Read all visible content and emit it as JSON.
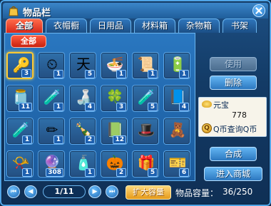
{
  "window": {
    "title": "物品栏"
  },
  "tabs": [
    {
      "label": "全部",
      "active": true
    },
    {
      "label": "衣帽橱",
      "active": false
    },
    {
      "label": "日用品",
      "active": false
    },
    {
      "label": "材料箱",
      "active": false
    },
    {
      "label": "杂物箱",
      "active": false
    },
    {
      "label": "书架",
      "active": false
    }
  ],
  "subtab": {
    "label": "全部"
  },
  "items": [
    {
      "icon": "magnifier-key-icon",
      "glyph": "🔑",
      "count": "3",
      "selected": true
    },
    {
      "icon": "clock-hat-icon",
      "glyph": "⏲",
      "count": "1"
    },
    {
      "icon": "blue-sticker-icon",
      "glyph": "天",
      "count": "5"
    },
    {
      "icon": "noodle-bowl-icon",
      "glyph": "🍜",
      "count": "1"
    },
    {
      "icon": "scroll-icon",
      "glyph": "📜",
      "count": "1"
    },
    {
      "icon": "battery-icon",
      "glyph": "🔋",
      "count": "1"
    },
    {
      "icon": "jar-icon",
      "glyph": "🫙",
      "count": "11"
    },
    {
      "icon": "red-vial-icon",
      "glyph": "🧪",
      "count": "1"
    },
    {
      "icon": "green-potion-icon",
      "glyph": "🍶",
      "count": "4"
    },
    {
      "icon": "clover-icon",
      "glyph": "🍀",
      "count": "3"
    },
    {
      "icon": "orange-vial-icon",
      "glyph": "🧪",
      "count": "5"
    },
    {
      "icon": "purple-book-icon",
      "glyph": "📘",
      "count": "4"
    },
    {
      "icon": "blue-vial-icon",
      "glyph": "🧪",
      "count": "1"
    },
    {
      "icon": "pencil-icon",
      "glyph": "✏",
      "count": "1"
    },
    {
      "icon": "green-bottle-icon",
      "glyph": "🍾",
      "count": "2"
    },
    {
      "icon": "green-book-icon",
      "glyph": "📗",
      "count": "12"
    },
    {
      "icon": "red-hat-icon",
      "glyph": "🎩",
      "count": ""
    },
    {
      "icon": "purple-figure-icon",
      "glyph": "🧸",
      "count": ""
    },
    {
      "icon": "horn-icon",
      "glyph": "📯",
      "count": "1"
    },
    {
      "icon": "crystal-ball-icon",
      "glyph": "🔮",
      "count": "308"
    },
    {
      "icon": "small-bottle-icon",
      "glyph": "🧴",
      "count": "1"
    },
    {
      "icon": "pumpkin-icon",
      "glyph": "🎃",
      "count": "2"
    },
    {
      "icon": "green-package-icon",
      "glyph": "🎁",
      "count": "5"
    },
    {
      "icon": "tickets-icon",
      "glyph": "🎫",
      "count": "6"
    }
  ],
  "side": {
    "use_label": "使用",
    "delete_label": "删除",
    "currency_label": "元宝",
    "currency_value": "778",
    "qcoin_link": "Q币查询Q币",
    "qcoin_glyph": "Q",
    "craft_label": "合成",
    "shop_label": "进入商城"
  },
  "pager": {
    "text": "1/11"
  },
  "bottom": {
    "expand_label": "扩大容量",
    "capacity_label": "物品容量：",
    "capacity_value": "36/250"
  }
}
